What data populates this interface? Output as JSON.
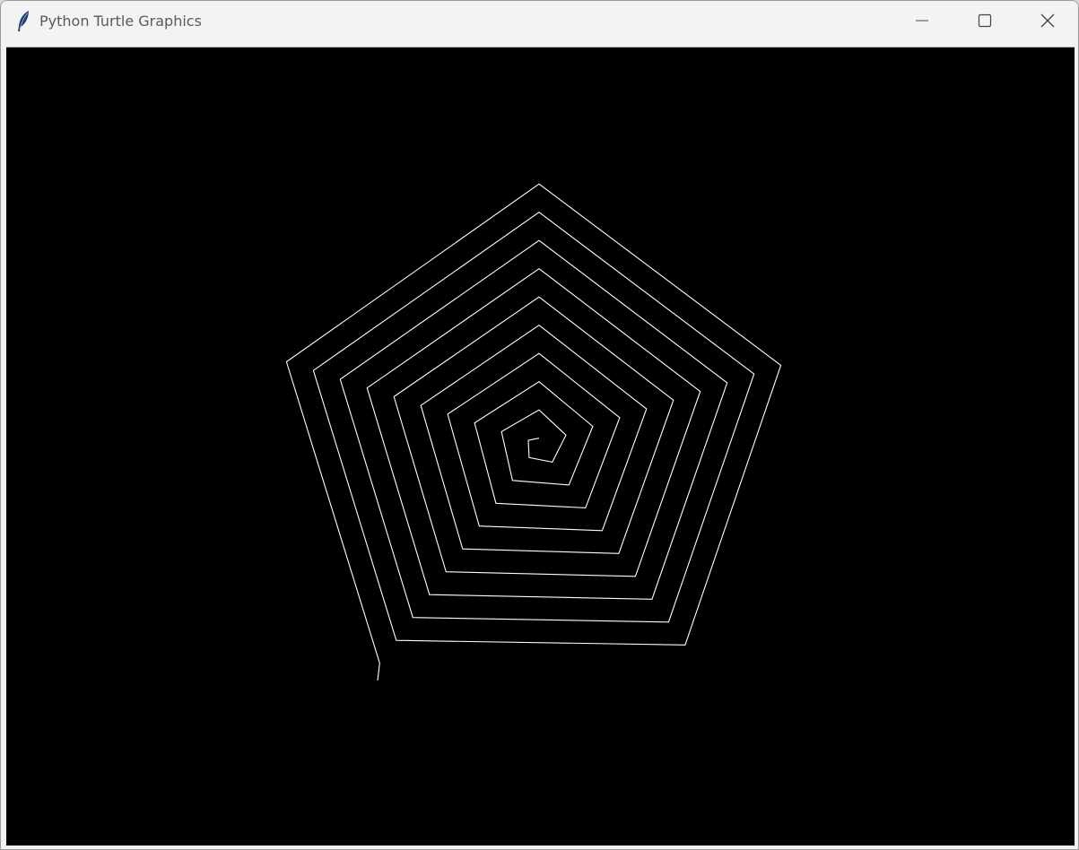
{
  "window": {
    "title": "Python Turtle Graphics",
    "icon": "feather-icon",
    "controls": {
      "minimize": "minimize-icon",
      "maximize": "maximize-icon",
      "close": "close-icon"
    }
  },
  "canvas": {
    "background": "#000000",
    "pen_color": "#ffffff",
    "drawing": "pentagon-spiral"
  },
  "colors": {
    "titlebar": "#f3f3f3",
    "title_text": "#5a5a5a",
    "icon_blue": "#1f3a6b"
  }
}
